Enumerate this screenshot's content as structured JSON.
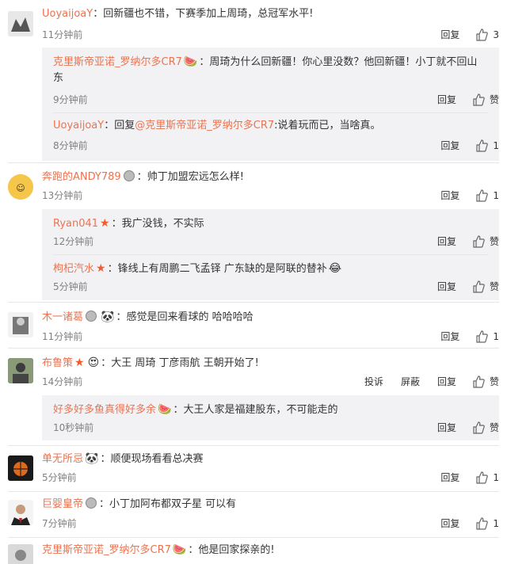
{
  "actions": {
    "reply": "回复",
    "report": "投诉",
    "block": "屏蔽",
    "like": "赞"
  },
  "colors": {
    "username": "#eb7350",
    "time": "#808080",
    "subbg": "#f2f2f5"
  },
  "comments": [
    {
      "user": "UoyaijoaY",
      "text": "回新疆也不错，下赛季加上周琦，总冠军水平!",
      "time": "11分钟前",
      "likes": "3"
    },
    {
      "user": "奔跑的ANDY789",
      "text": "帅丁加盟宏远怎么样!",
      "time": "13分钟前",
      "likes": "1"
    },
    {
      "user": "木一诸葛",
      "text": "感觉是回来看球的 哈哈哈哈",
      "time": "11分钟前",
      "likes": "1"
    },
    {
      "user": "布鲁策",
      "text": "大王 周琦 丁彦雨航 王朝开始了!",
      "time": "14分钟前",
      "likes": ""
    },
    {
      "user": "单无所忌",
      "text": "顺便现场看看总决赛",
      "time": "5分钟前",
      "likes": "1"
    },
    {
      "user": "巨婴皇帝",
      "text": "小丁加阿布都双子星 可以有",
      "time": "7分钟前",
      "likes": "1"
    },
    {
      "user": "克里斯帝亚诺_罗纳尔多CR7",
      "text": "他是回家探亲的!"
    }
  ],
  "replies": [
    {
      "user": "克里斯帝亚诺_罗纳尔多CR7",
      "text": "周琦为什么回新疆！你心里没数？他回新疆！小丁就不回山",
      "text2": "东",
      "time": "9分钟前"
    },
    {
      "user": "UoyaijoaY",
      "prefix": "回复",
      "mention": "@克里斯帝亚诺_罗纳尔多CR7",
      "text": ":说着玩而已，当啥真。",
      "time": "8分钟前",
      "likes": "1"
    },
    {
      "user": "Ryan041",
      "text": "我广没钱，不实际",
      "time": "12分钟前"
    },
    {
      "user": "枸杞汽水",
      "text": "锋线上有周鹏二飞孟铎 广东缺的是阿联的替补",
      "time": "5分钟前"
    },
    {
      "user": "好多好多鱼真得好多余",
      "text": "大王人家是福建股东，不可能走的",
      "time": "10秒钟前"
    }
  ]
}
